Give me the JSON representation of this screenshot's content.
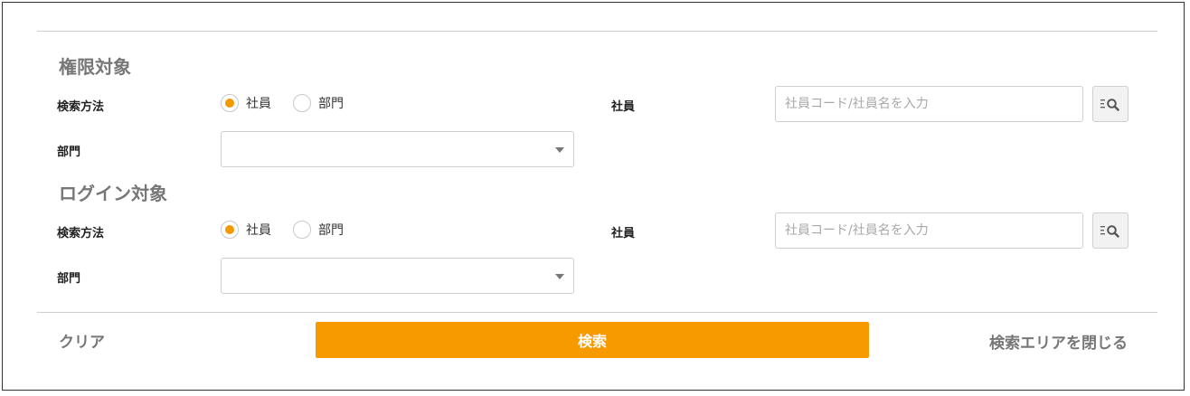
{
  "sections": [
    {
      "title": "権限対象",
      "search_method_label": "検索方法",
      "radio_options": [
        {
          "label": "社員",
          "checked": true
        },
        {
          "label": "部門",
          "checked": false
        }
      ],
      "employee_label": "社員",
      "employee_placeholder": "社員コード/社員名を入力",
      "employee_value": "",
      "department_label": "部門",
      "department_value": ""
    },
    {
      "title": "ログイン対象",
      "search_method_label": "検索方法",
      "radio_options": [
        {
          "label": "社員",
          "checked": true
        },
        {
          "label": "部門",
          "checked": false
        }
      ],
      "employee_label": "社員",
      "employee_placeholder": "社員コード/社員名を入力",
      "employee_value": "",
      "department_label": "部門",
      "department_value": ""
    }
  ],
  "footer": {
    "clear_label": "クリア",
    "search_label": "検索",
    "close_label": "検索エリアを閉じる"
  },
  "colors": {
    "accent": "#f79a00",
    "radio_selected": "#f39a00",
    "muted_text": "#777777",
    "border": "#cfcfcf"
  },
  "icons": {
    "employee_search_button": "list-search-icon",
    "department_select_caret": "caret-down-icon"
  }
}
